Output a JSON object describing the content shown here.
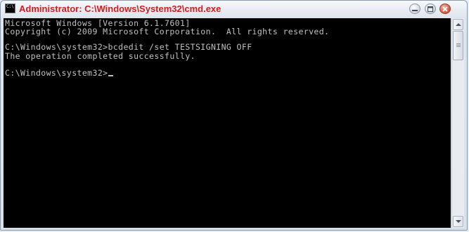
{
  "window": {
    "title": "Administrator: C:\\Windows\\System32\\cmd.exe",
    "icon": "cmd-icon",
    "icon_text": "C:\\",
    "title_color": "#d31d1d"
  },
  "controls": {
    "minimize": "minimize-icon",
    "maximize": "maximize-icon",
    "close": "close-icon"
  },
  "console": {
    "background": "#000000",
    "foreground": "#c0c0c0",
    "lines": [
      "Microsoft Windows [Version 6.1.7601]",
      "Copyright (c) 2009 Microsoft Corporation.  All rights reserved.",
      "",
      "C:\\Windows\\system32>bcdedit /set TESTSIGNING OFF",
      "The operation completed successfully.",
      "",
      "C:\\Windows\\system32>"
    ]
  }
}
